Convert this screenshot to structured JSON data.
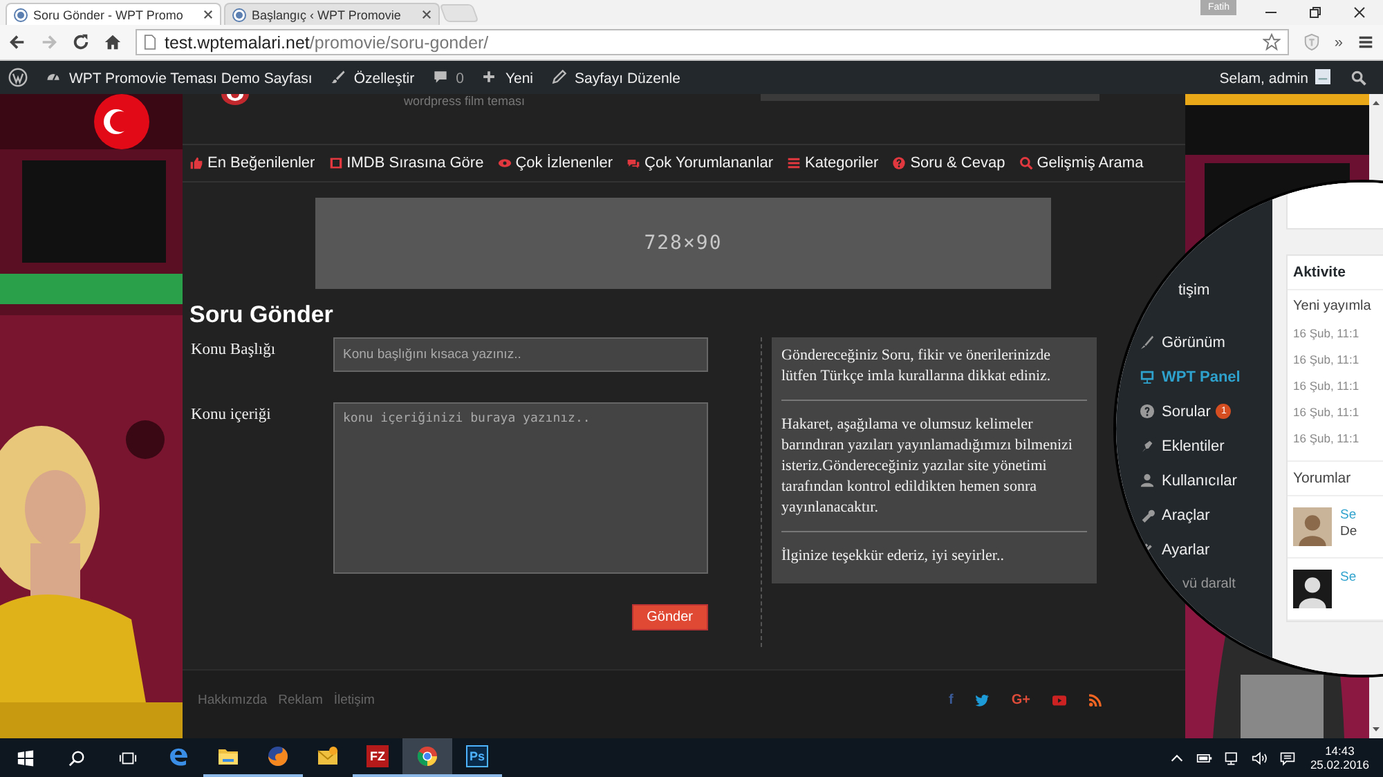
{
  "browser": {
    "tabs": [
      {
        "title": "Soru Gönder - WPT Promo",
        "selected": true
      },
      {
        "title": "Başlangıç ‹ WPT Promovie",
        "selected": false
      }
    ],
    "profile": "Fatih",
    "address": {
      "host": "test.wptemalari.net",
      "path": "/promovie/soru-gonder/"
    },
    "overflow": "»"
  },
  "admin_bar": {
    "site": "WPT Promovie Teması Demo Sayfası",
    "customize": "Özelleştir",
    "comments": "0",
    "new": "Yeni",
    "edit": "Sayfayı Düzenle",
    "greeting": "Selam, admin"
  },
  "site": {
    "tagline": "wordpress film teması",
    "nav": [
      "En Beğenilenler",
      "IMDB Sırasına Göre",
      "Çok İzlenenler",
      "Çok Yorumlananlar",
      "Kategoriler",
      "Soru & Cevap",
      "Gelişmiş Arama"
    ],
    "ad_placeholder": "728×90"
  },
  "form": {
    "title": "Soru Gönder",
    "fields": [
      {
        "label": "Konu Başlığı",
        "placeholder": "Konu başlığını kısaca yazınız..",
        "kind": "input"
      },
      {
        "label": "Konu içeriği",
        "placeholder": "konu içeriğinizi buraya yazınız..",
        "kind": "textarea"
      }
    ],
    "submit": "Gönder"
  },
  "notice": [
    "Göndereceğiniz Soru, fikir ve önerilerinizde lütfen Türkçe imla kurallarına dikkat ediniz.",
    "Hakaret, aşağılama ve olumsuz kelimeler barındıran yazıları yayınlamadığımızı bilmenizi isteriz.Göndereceğiniz yazılar site yönetimi tarafından kontrol edildikten hemen sonra yayınlanacaktır.",
    "İlginize teşekkür ederiz, iyi seyirler.."
  ],
  "footer": {
    "links": [
      "Hakkımızda",
      "Reklam",
      "İletişim"
    ],
    "social": [
      {
        "kind": "glyph",
        "glyph": "f",
        "color": "#3b5b98"
      },
      {
        "kind": "twitter",
        "color": "#1d9bd8"
      },
      {
        "kind": "glyph",
        "glyph": "G+",
        "color": "#dd4b39"
      },
      {
        "kind": "youtube",
        "color": "#cc2222"
      },
      {
        "kind": "rss",
        "color": "#f26522"
      }
    ]
  },
  "magnifier": {
    "menu": [
      {
        "label": "tişim",
        "kind": "partial",
        "selected": false
      },
      {
        "label": "Görünüm",
        "kind": "item",
        "selected": false
      },
      {
        "label": "WPT Panel",
        "kind": "item",
        "selected": true
      },
      {
        "label": "Sorular",
        "kind": "item",
        "selected": false,
        "badge": "1"
      },
      {
        "label": "Eklentiler",
        "kind": "item",
        "selected": false
      },
      {
        "label": "Kullanıcılar",
        "kind": "item",
        "selected": false
      },
      {
        "label": "Araçlar",
        "kind": "item",
        "selected": false
      },
      {
        "label": "Ayarlar",
        "kind": "item",
        "selected": false
      },
      {
        "label": "vü daralt",
        "kind": "collapse",
        "selected": false
      }
    ],
    "activity": {
      "title": "Aktivite",
      "heading": "Yeni yayımla",
      "dates": [
        "16 Şub, 11:1",
        "16 Şub, 11:1",
        "16 Şub, 11:1",
        "16 Şub, 11:1",
        "16 Şub, 11:1"
      ],
      "comments_heading": "Yorumlar",
      "comments": [
        {
          "author": "Se",
          "excerpt": "De"
        },
        {
          "author": "Se"
        }
      ]
    }
  },
  "taskbar": {
    "apps": [
      {
        "kind": "edge",
        "open": false,
        "selected": false
      },
      {
        "kind": "explorer",
        "open": true,
        "selected": false
      },
      {
        "kind": "firefox",
        "open": true,
        "selected": false
      },
      {
        "kind": "mail",
        "open": false,
        "selected": false
      },
      {
        "kind": "filezilla",
        "glyph": "FZ",
        "open": true,
        "selected": false
      },
      {
        "kind": "chrome",
        "open": true,
        "selected": true
      },
      {
        "kind": "photoshop",
        "glyph": "Ps",
        "open": true,
        "selected": false
      }
    ],
    "time": "14:43",
    "date": "25.02.2016"
  }
}
